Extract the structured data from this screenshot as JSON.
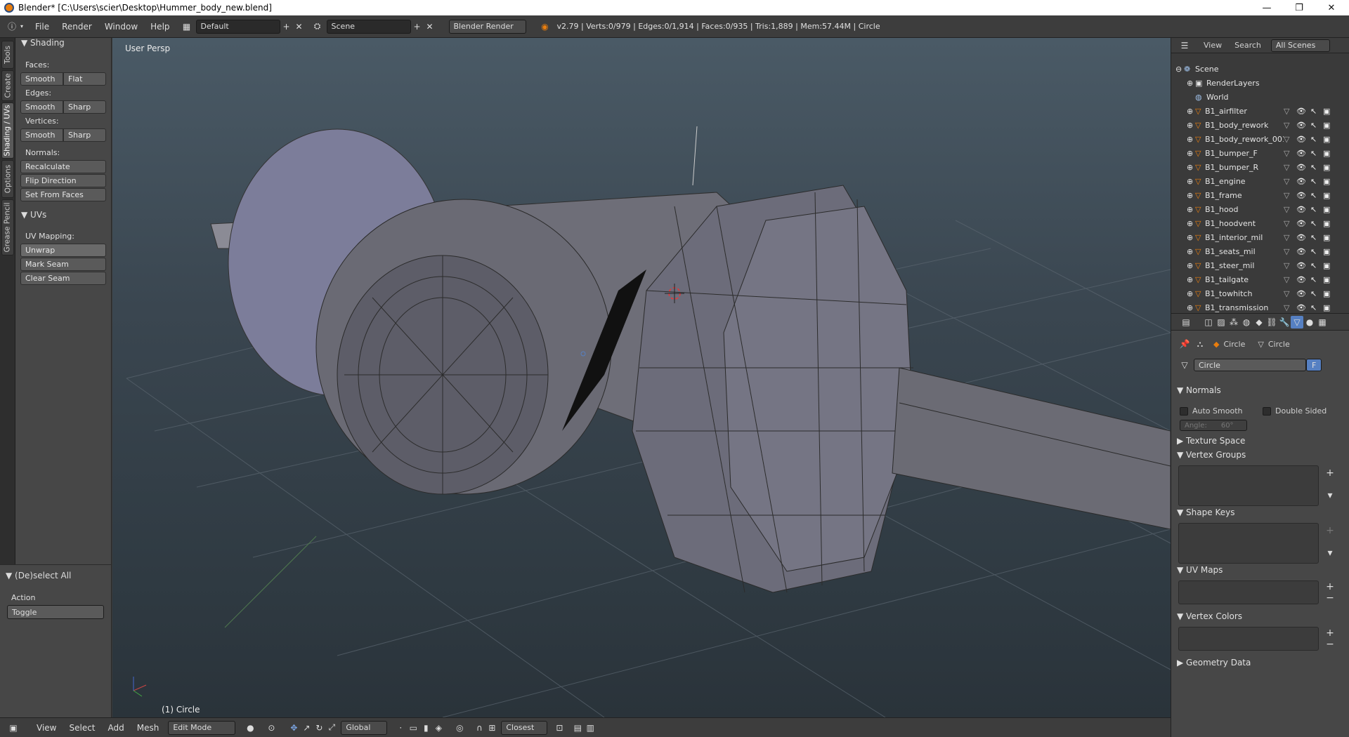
{
  "window": {
    "title": "Blender* [C:\\Users\\scier\\Desktop\\Hummer_body_new.blend]",
    "minimize": "—",
    "restore": "❐",
    "close": "✕"
  },
  "topbar": {
    "menus": [
      "File",
      "Render",
      "Window",
      "Help"
    ],
    "layout": "Default",
    "scene": "Scene",
    "engine": "Blender Render",
    "stats": "v2.79 | Verts:0/979 | Edges:0/1,914 | Faces:0/935 | Tris:1,889 | Mem:57.44M | Circle"
  },
  "left_tabs": [
    "Tools",
    "Create",
    "Shading / UVs",
    "Options",
    "Grease Pencil"
  ],
  "toolshelf": {
    "shading_header": "Shading",
    "faces_label": "Faces:",
    "faces_buttons": [
      "Smooth",
      "Flat"
    ],
    "edges_label": "Edges:",
    "edges_buttons": [
      "Smooth",
      "Sharp"
    ],
    "vertices_label": "Vertices:",
    "vertices_buttons": [
      "Smooth",
      "Sharp"
    ],
    "normals_label": "Normals:",
    "normals_buttons": [
      "Recalculate",
      "Flip Direction",
      "Set From Faces"
    ],
    "uvs_header": "UVs",
    "uv_mapping_label": "UV Mapping:",
    "uv_buttons": [
      "Unwrap",
      "Mark Seam",
      "Clear Seam"
    ]
  },
  "operator": {
    "header": "(De)select All",
    "action_label": "Action",
    "action_value": "Toggle"
  },
  "viewport": {
    "view_name": "User Persp",
    "object_label": "(1) Circle"
  },
  "bottombar": {
    "menus": [
      "View",
      "Select",
      "Add",
      "Mesh"
    ],
    "mode": "Edit Mode",
    "orientation": "Global",
    "snap": "Closest"
  },
  "outliner": {
    "header_items": [
      "View",
      "Search",
      "All Scenes"
    ],
    "scene": "Scene",
    "renderlayers": "RenderLayers",
    "world": "World",
    "objects": [
      "B1_airfilter",
      "B1_body_rework",
      "B1_body_rework_001",
      "B1_bumper_F",
      "B1_bumper_R",
      "B1_engine",
      "B1_frame",
      "B1_hood",
      "B1_hoodvent",
      "B1_interior_mil",
      "B1_seats_mil",
      "B1_steer_mil",
      "B1_tailgate",
      "B1_towhitch",
      "B1_transmission"
    ]
  },
  "properties": {
    "breadcrumb_object": "Circle",
    "breadcrumb_mesh": "Circle",
    "mesh_name": "Circle",
    "fake_user": "F",
    "normals_header": "Normals",
    "auto_smooth": "Auto Smooth",
    "double_sided": "Double Sided",
    "angle": "Angle:",
    "angle_value": "60°",
    "texture_space": "Texture Space",
    "vertex_groups": "Vertex Groups",
    "shape_keys": "Shape Keys",
    "uv_maps": "UV Maps",
    "vertex_colors": "Vertex Colors",
    "geometry_data": "Geometry Data"
  },
  "colors": {
    "accent_orange": "#e87d0d",
    "viewport_bg": "#3a4650",
    "mesh_face": "#6a6a78",
    "selected_blue": "#5680c2"
  }
}
